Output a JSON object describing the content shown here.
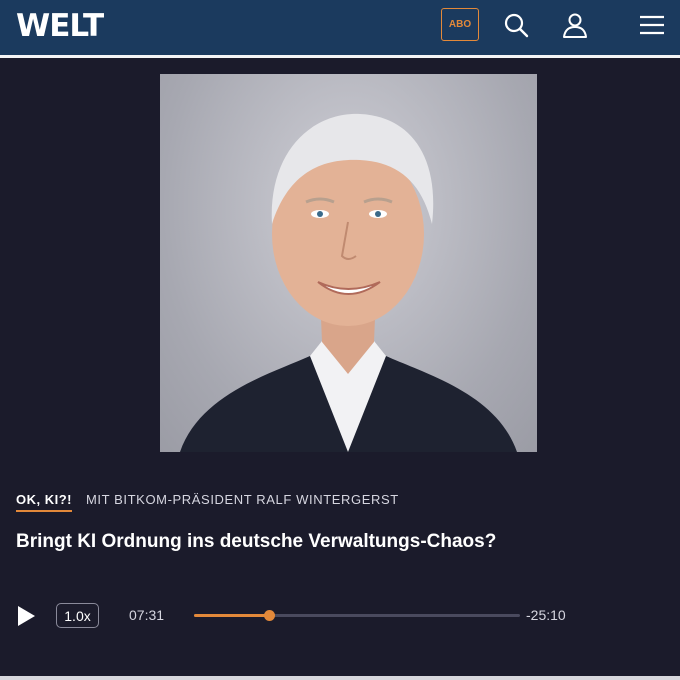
{
  "header": {
    "logo": "WELT",
    "abo_label": "ABO",
    "icons": [
      "search-icon",
      "user-icon",
      "menu-icon"
    ],
    "background_color": "#1b3a5e",
    "accent_color": "#e3893a"
  },
  "episode": {
    "kicker": "OK, KI?!",
    "subtitle": "MIT BITKOM-PRÄSIDENT RALF WINTERGERST",
    "title": "Bringt KI Ordnung ins deutsche Verwaltungs-Chaos?"
  },
  "player": {
    "speed": "1.0x",
    "elapsed": "07:31",
    "remaining": "-25:10",
    "progress": 0.23,
    "play_icon": "play-icon"
  }
}
